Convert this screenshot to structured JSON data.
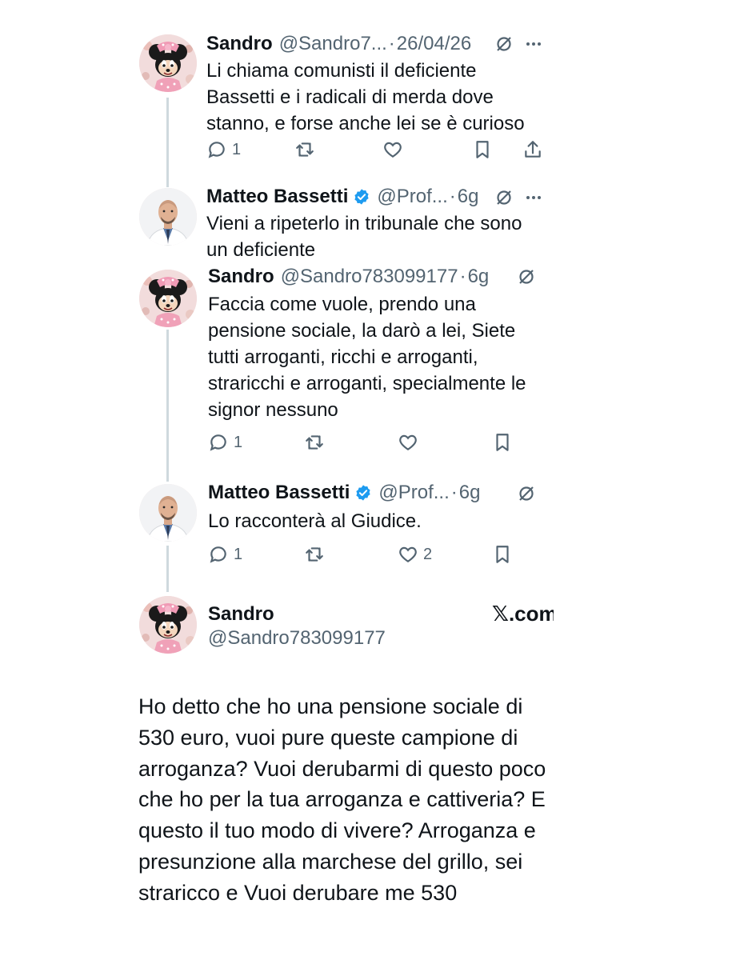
{
  "tweets": [
    {
      "name": "Sandro",
      "handle": "@Sandro7...",
      "time": "26/04/26",
      "text": "Li chiama comunisti il deficiente\nBassetti e i radicali di merda dove\nstanno, e forse anche lei se è curioso",
      "replies": "1",
      "likes": ""
    },
    {
      "name": "Matteo Bassetti",
      "handle": "@Prof...",
      "time": "6g",
      "text": "Vieni a ripeterlo in tribunale che sono\nun deficiente"
    },
    {
      "name": "Sandro",
      "handle": "@Sandro783099177",
      "time": "6g",
      "text": "Faccia come vuole, prendo una\npensione sociale, la darò a lei, Siete\ntutti arroganti, ricchi e arroganti,\nstraricchi e arroganti, specialmente le\nsignor nessuno",
      "replies": "1",
      "likes": ""
    },
    {
      "name": "Matteo Bassetti",
      "handle": "@Prof...",
      "time": "6g",
      "text": "Lo racconterà al Giudice.",
      "replies": "1",
      "likes": "2"
    }
  ],
  "main_tweet": {
    "name": "Sandro",
    "handle": "@Sandro783099177",
    "brand": "𝕏.com",
    "text": "Ho detto che ho una pensione sociale di 530 euro, vuoi pure queste campione di arroganza? Vuoi derubarmi di questo poco che ho per la tua arroganza e cattiveria? E questo il tuo modo di vivere? Arroganza e presunzione alla marchese del grillo, sei straricco e Vuoi derubare me 530"
  },
  "separator": "·",
  "icons": {
    "reply": "reply-icon",
    "retweet": "retweet-icon",
    "like": "heart-icon",
    "bookmark": "bookmark-icon",
    "share": "share-icon",
    "grok": "grok-icon",
    "more": "more-icon",
    "verified": "verified-badge-icon"
  },
  "colors": {
    "text": "#0f1419",
    "secondary": "#536471",
    "verified": "#1d9bf0",
    "thread_line": "#cfd9de"
  }
}
